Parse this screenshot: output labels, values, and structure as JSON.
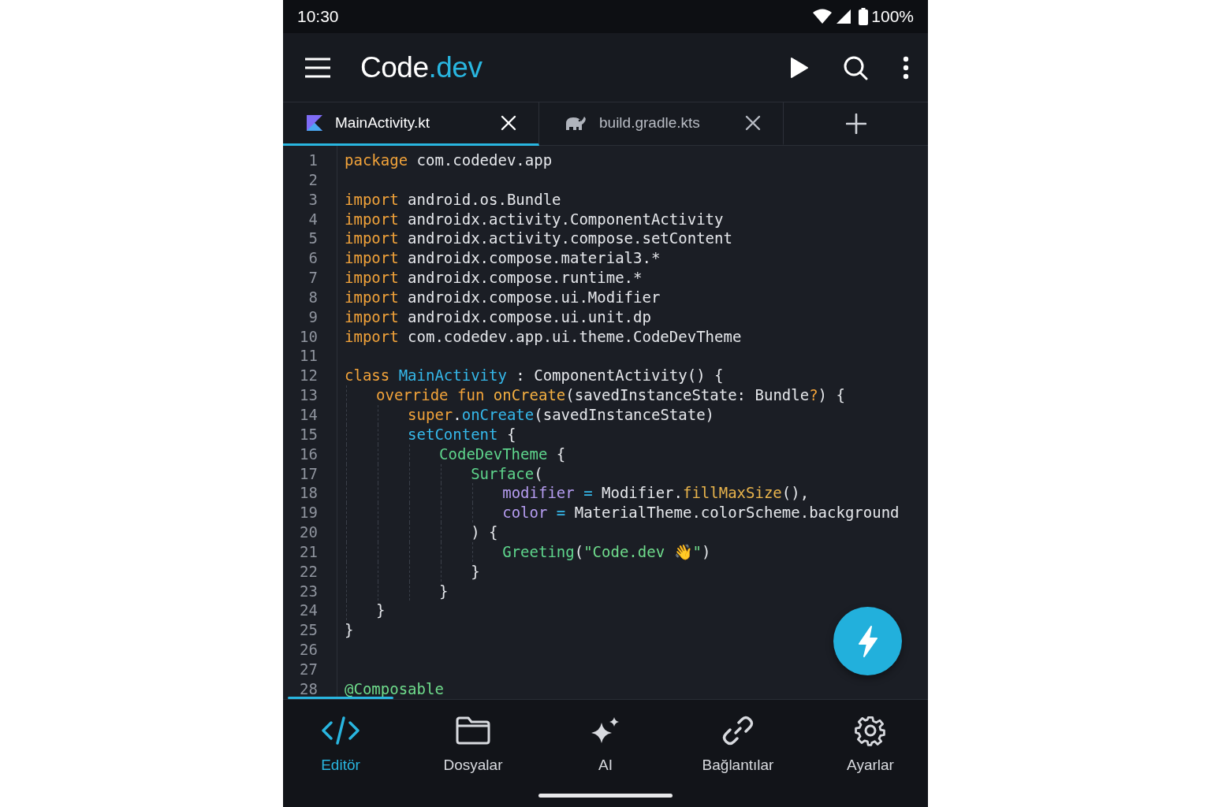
{
  "status_bar": {
    "time": "10:30",
    "battery": "100%"
  },
  "app_bar": {
    "title": "Code",
    "title_accent": ".dev"
  },
  "tabs": [
    {
      "label": "MainActivity.kt",
      "kind": "kotlin",
      "selected": true
    },
    {
      "label": "build.gradle.kts",
      "kind": "gradle",
      "selected": false
    }
  ],
  "editor": {
    "lines": [
      {
        "number": "1",
        "tokens": [
          {
            "text": "package",
            "kind": "keyword"
          },
          {
            "text": " com.codedev.app",
            "kind": "plain"
          }
        ]
      },
      {
        "number": "2"
      },
      {
        "number": "3",
        "tokens": [
          {
            "text": "import",
            "kind": "keyword"
          },
          {
            "text": " android.os.Bundle",
            "kind": "plain"
          }
        ]
      },
      {
        "number": "4",
        "tokens": [
          {
            "text": "import",
            "kind": "keyword"
          },
          {
            "text": " androidx.activity.ComponentActivity",
            "kind": "plain"
          }
        ]
      },
      {
        "number": "5",
        "tokens": [
          {
            "text": "import",
            "kind": "keyword"
          },
          {
            "text": " androidx.activity.compose.setContent",
            "kind": "plain"
          }
        ]
      },
      {
        "number": "6",
        "tokens": [
          {
            "text": "import",
            "kind": "keyword"
          },
          {
            "text": " androidx.compose.material3.*",
            "kind": "plain"
          }
        ]
      },
      {
        "number": "7",
        "tokens": [
          {
            "text": "import",
            "kind": "keyword"
          },
          {
            "text": " androidx.compose.runtime.*",
            "kind": "plain"
          }
        ]
      },
      {
        "number": "8",
        "tokens": [
          {
            "text": "import",
            "kind": "keyword"
          },
          {
            "text": " androidx.compose.ui.Modifier",
            "kind": "plain"
          }
        ]
      },
      {
        "number": "9",
        "tokens": [
          {
            "text": "import",
            "kind": "keyword"
          },
          {
            "text": " androidx.compose.ui.unit.dp",
            "kind": "plain"
          }
        ]
      },
      {
        "number": "10",
        "tokens": [
          {
            "text": "import",
            "kind": "keyword"
          },
          {
            "text": " com.codedev.app.ui.theme.CodeDevTheme",
            "kind": "plain"
          }
        ]
      },
      {
        "number": "11"
      },
      {
        "number": "12",
        "tokens": [
          {
            "text": "class ",
            "kind": "keyword"
          },
          {
            "text": "MainActivity",
            "kind": "type"
          },
          {
            "text": " : ComponentActivity() {",
            "kind": "plain"
          }
        ]
      },
      {
        "number": "13",
        "tokens": [
          {
            "text": "\toverride fun ",
            "kind": "keyword"
          },
          {
            "text": "onCreate",
            "kind": "decl"
          },
          {
            "text": "(savedInstanceState: Bundle",
            "kind": "plain"
          },
          {
            "text": "?",
            "kind": "keyword"
          },
          {
            "text": ") {",
            "kind": "plain"
          }
        ]
      },
      {
        "number": "14",
        "tokens": [
          {
            "text": "\t\tsuper",
            "kind": "keyword"
          },
          {
            "text": ".",
            "kind": "plain"
          },
          {
            "text": "onCreate",
            "kind": "call"
          },
          {
            "text": "(savedInstanceState)",
            "kind": "plain"
          }
        ]
      },
      {
        "number": "15",
        "tokens": [
          {
            "text": "\t\tsetContent",
            "kind": "call"
          },
          {
            "text": " {",
            "kind": "plain"
          }
        ]
      },
      {
        "number": "16",
        "tokens": [
          {
            "text": "\t\t\tCodeDevTheme",
            "kind": "composable"
          },
          {
            "text": " {",
            "kind": "plain"
          }
        ]
      },
      {
        "number": "17",
        "tokens": [
          {
            "text": "\t\t\t\tSurface",
            "kind": "composable"
          },
          {
            "text": "(",
            "kind": "plain"
          }
        ]
      },
      {
        "number": "18",
        "tokens": [
          {
            "text": "\t\t\t\t\tmodifier",
            "kind": "param"
          },
          {
            "text": " = ",
            "kind": "operator"
          },
          {
            "text": "Modifier.",
            "kind": "plain"
          },
          {
            "text": "fillMaxSize",
            "kind": "method"
          },
          {
            "text": "(),",
            "kind": "plain"
          }
        ]
      },
      {
        "number": "19",
        "tokens": [
          {
            "text": "\t\t\t\t\tcolor",
            "kind": "param"
          },
          {
            "text": " = ",
            "kind": "operator"
          },
          {
            "text": "MaterialTheme.colorScheme.background",
            "kind": "plain"
          }
        ]
      },
      {
        "number": "20",
        "tokens": [
          {
            "text": "\t\t\t\t) {",
            "kind": "plain"
          }
        ]
      },
      {
        "number": "21",
        "tokens": [
          {
            "text": "\t\t\t\t\tGreeting",
            "kind": "composable"
          },
          {
            "text": "(",
            "kind": "plain"
          },
          {
            "text": "\"Code.dev 👋\"",
            "kind": "string"
          },
          {
            "text": ")",
            "kind": "plain"
          }
        ]
      },
      {
        "number": "22",
        "tokens": [
          {
            "text": "\t\t\t\t}",
            "kind": "plain"
          }
        ]
      },
      {
        "number": "23",
        "tokens": [
          {
            "text": "\t\t\t}",
            "kind": "plain"
          }
        ]
      },
      {
        "number": "24",
        "tokens": [
          {
            "text": "\t}",
            "kind": "plain"
          }
        ]
      },
      {
        "number": "25",
        "tokens": [
          {
            "text": "}",
            "kind": "plain"
          }
        ]
      },
      {
        "number": "26"
      },
      {
        "number": "27"
      },
      {
        "number": "28",
        "tokens": [
          {
            "text": "@Composable",
            "kind": "annotation"
          }
        ]
      }
    ]
  },
  "bottom_nav": [
    {
      "label": "Editör",
      "kind": "code",
      "selected": true
    },
    {
      "label": "Dosyalar",
      "kind": "folder",
      "selected": false
    },
    {
      "label": "AI",
      "kind": "sparkle",
      "selected": false
    },
    {
      "label": "Bağlantılar",
      "kind": "link",
      "selected": false
    },
    {
      "label": "Ayarlar",
      "kind": "gear",
      "selected": false
    }
  ]
}
